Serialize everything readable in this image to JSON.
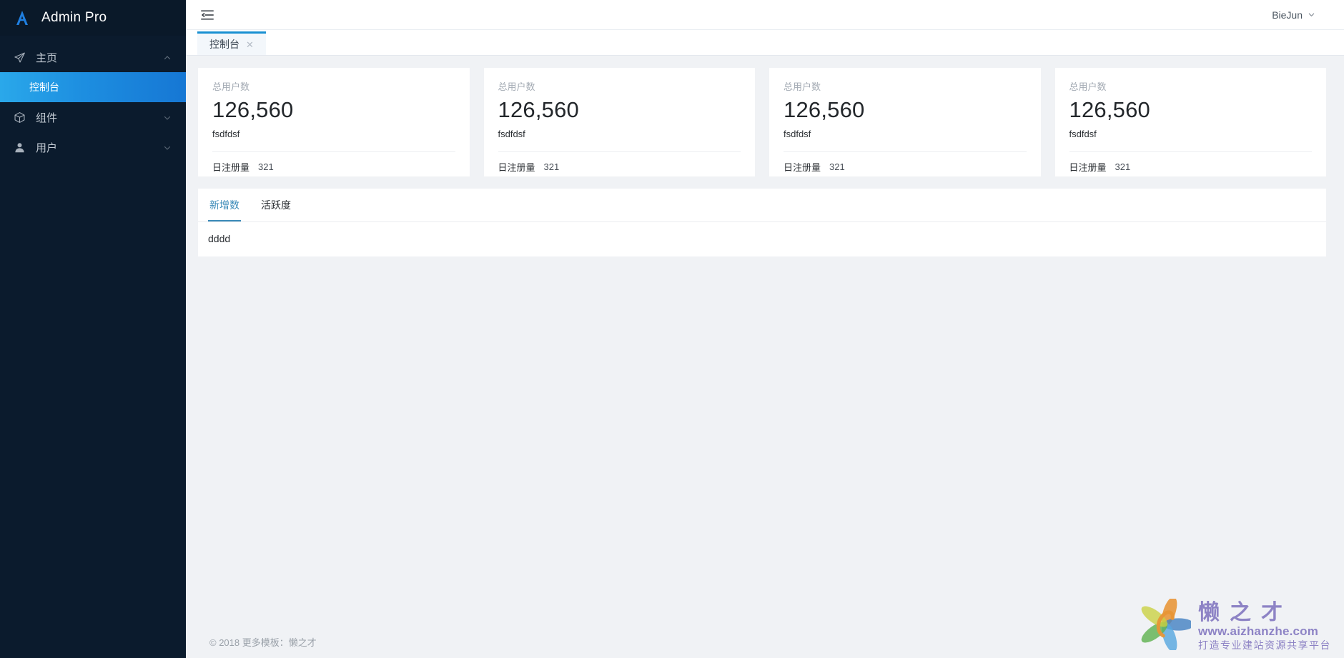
{
  "app": {
    "logo_icon": "letter-a-logo-icon",
    "title": "Admin Pro"
  },
  "sidebar": {
    "items": [
      {
        "label": "主页",
        "icon": "paper-plane-icon",
        "chevron": "chevron-up-icon",
        "expanded": true,
        "children": [
          {
            "label": "控制台",
            "active": true
          }
        ]
      },
      {
        "label": "组件",
        "icon": "cube-icon",
        "chevron": "chevron-down-icon",
        "expanded": false
      },
      {
        "label": "用户",
        "icon": "user-icon",
        "chevron": "chevron-down-icon",
        "expanded": false
      }
    ]
  },
  "topbar": {
    "fold_icon": "menu-fold-icon",
    "user_name": "BieJun",
    "user_chevron": "chevron-down-icon"
  },
  "tabstrip": {
    "tabs": [
      {
        "label": "控制台",
        "active": true,
        "close_icon": "close-icon",
        "close_glyph": "✕"
      }
    ]
  },
  "cards": [
    {
      "label": "总用户数",
      "value": "126,560",
      "sub": "fsdfdsf",
      "footer_label": "日注册量",
      "footer_value": "321"
    },
    {
      "label": "总用户数",
      "value": "126,560",
      "sub": "fsdfdsf",
      "footer_label": "日注册量",
      "footer_value": "321"
    },
    {
      "label": "总用户数",
      "value": "126,560",
      "sub": "fsdfdsf",
      "footer_label": "日注册量",
      "footer_value": "321"
    },
    {
      "label": "总用户数",
      "value": "126,560",
      "sub": "fsdfdsf",
      "footer_label": "日注册量",
      "footer_value": "321"
    }
  ],
  "panel": {
    "tabs": [
      {
        "label": "新增数",
        "active": true
      },
      {
        "label": "活跃度",
        "active": false
      }
    ],
    "body": "dddd"
  },
  "footer": {
    "text": "© 2018 更多模板：懒之才"
  },
  "watermark": {
    "logo_icon": "swirl-logo-icon",
    "brand": "懒之才",
    "url": "www.aizhanzhe.com",
    "slogan": "打造专业建站资源共享平台"
  },
  "colors": {
    "sidebar_bg": "#0b1b2d",
    "sidebar_header_bg": "#0a1929",
    "active_gradient_start": "#2aa8ea",
    "active_gradient_end": "#1677d4",
    "accent_blue": "#1890d2",
    "panel_tab_active": "#3a8ab8",
    "page_bg": "#f0f2f5",
    "card_bg": "#ffffff",
    "watermark_purple": "#8a7fc4"
  }
}
